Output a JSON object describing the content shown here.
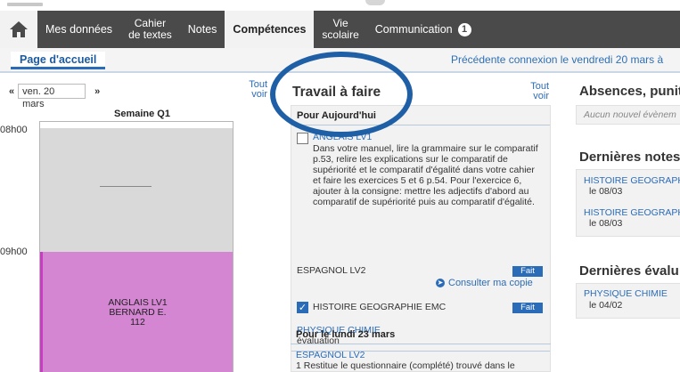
{
  "nav": {
    "items": [
      {
        "label": "Mes données"
      },
      {
        "label1": "Cahier",
        "label2": "de textes"
      },
      {
        "label": "Notes"
      },
      {
        "label": "Compétences"
      },
      {
        "label1": "Vie",
        "label2": "scolaire"
      },
      {
        "label": "Communication",
        "badge": "1"
      }
    ]
  },
  "subbar": {
    "tab": "Page d'accueil",
    "last_connection": "Précédente connexion le vendredi 20 mars à"
  },
  "agenda": {
    "date": "ven. 20 mars",
    "tout": "Tout",
    "voir": "voir",
    "week": "Semaine Q1",
    "hour1": "08h00",
    "hour2": "09h00",
    "lesson": {
      "subject": "ANGLAIS LV1",
      "teacher": "BERNARD E.",
      "room": "112"
    }
  },
  "homework": {
    "title": "Travail à faire",
    "tout": "Tout",
    "voir": "voir",
    "today_label": "Pour Aujourd'hui",
    "item1_subject": "ANGLAIS LV1",
    "item1_text": "Dans votre manuel, lire la grammaire sur le comparatif p.53, relire les explications sur le comparatif de supériorité et le comparatif d'égalité dans votre cahier et faire les exercices 5 et 6 p.54. Pour l'exercice 6, ajouter à la consigne: mettre les adjectifs d'abord au comparatif de supériorité puis au comparatif d'égalité.",
    "item2_subject": "ESPAGNOL LV2",
    "item2_status": "Fait",
    "consult_label": "Consulter ma copie",
    "item3_subject": "HISTOIRE GEOGRAPHIE EMC",
    "item3_status": "Fait",
    "item4_subject": "PHYSIQUE CHIMIE",
    "item4_text": "évaluation",
    "monday_label": "Pour le lundi 23 mars",
    "item5_subject": "ESPAGNOL LV2",
    "item5_text": "1 Restitue le questionnaire (complété) trouvé dans le"
  },
  "right": {
    "absences_title": "Absences, punit",
    "absences_empty": "Aucun nouvel évènem",
    "notes_title": "Dernières notes",
    "note1_subject": "HISTOIRE GEOGRAPH",
    "note1_date": "le 08/03",
    "note2_subject": "HISTOIRE GEOGRAPH",
    "note2_date": "le 08/03",
    "evals_title": "Dernières évalu",
    "eval1_subject": "PHYSIQUE CHIMIE",
    "eval1_date": "le 04/02"
  },
  "colors": {
    "nav_bg": "#4a4a4a",
    "accent": "#2b6cb8",
    "lesson": "#d486d2",
    "annotation": "#1f5fa6"
  }
}
